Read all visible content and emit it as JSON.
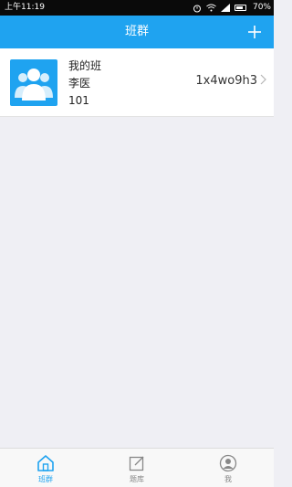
{
  "status_bar": {
    "time": "上午11:19",
    "battery": "70%"
  },
  "header": {
    "title": "班群",
    "add_icon": "plus-icon"
  },
  "class_card": {
    "name": "我的班",
    "teacher": "李医",
    "number": "101",
    "code": "1x4wo9h3",
    "avatar_icon": "group-icon"
  },
  "tabs": [
    {
      "label": "班群",
      "icon": "home-icon",
      "active": true
    },
    {
      "label": "题库",
      "icon": "edit-icon",
      "active": false
    },
    {
      "label": "我",
      "icon": "user-icon",
      "active": false
    }
  ],
  "colors": {
    "accent": "#1fa3f0",
    "background": "#efeff4"
  }
}
